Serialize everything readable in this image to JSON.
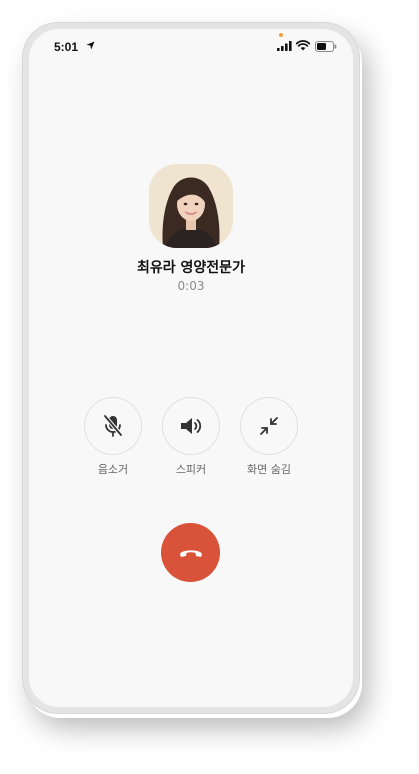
{
  "status_bar": {
    "time": "5:01",
    "location_icon": "location-arrow-icon",
    "indicator_color": "#f2a13a",
    "signal_icon": "cellular-signal-icon",
    "wifi_icon": "wifi-icon",
    "battery_icon": "battery-icon"
  },
  "caller": {
    "name": "최유라 영양전문가",
    "duration": "0:03",
    "avatar_icon": "caller-avatar"
  },
  "controls": [
    {
      "label": "음소거",
      "icon": "mic-off-icon"
    },
    {
      "label": "스피커",
      "icon": "speaker-icon"
    },
    {
      "label": "화면 숨김",
      "icon": "minimize-icon"
    }
  ],
  "end_call": {
    "icon": "hang-up-icon",
    "color": "#d9533a"
  },
  "colors": {
    "background": "#f8f8f8",
    "accent_red": "#d9533a"
  }
}
